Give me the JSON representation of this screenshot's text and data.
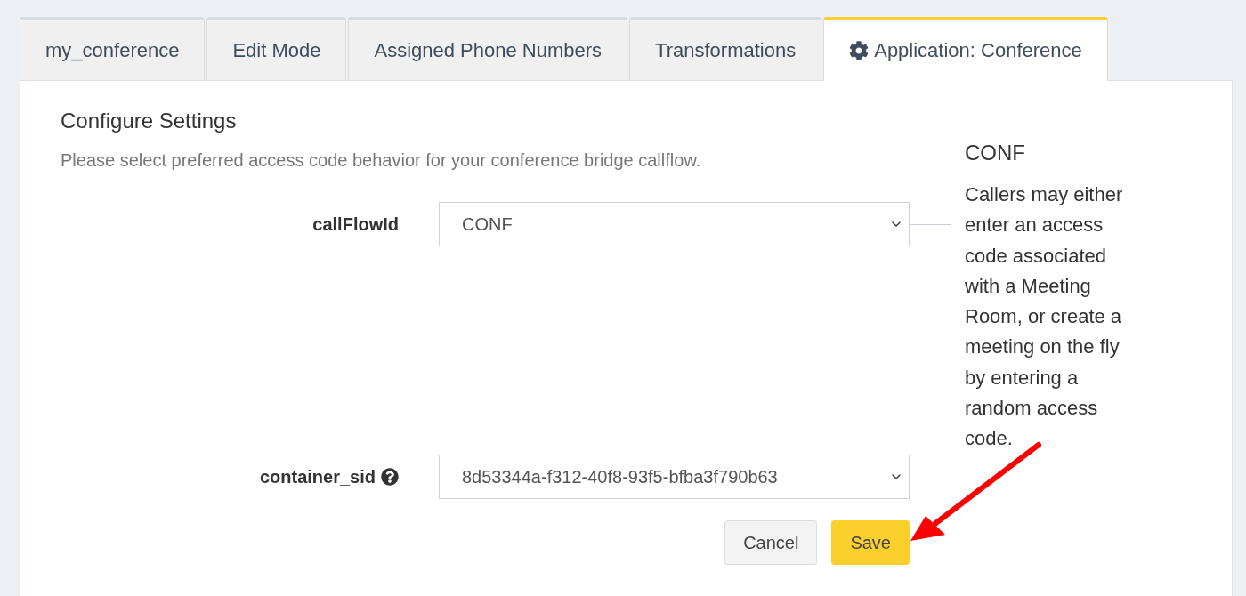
{
  "tabs": [
    {
      "label": "my_conference",
      "selected": false,
      "kind": "plain"
    },
    {
      "label": "Edit Mode",
      "selected": false,
      "kind": "plain"
    },
    {
      "label": "Assigned Phone Numbers",
      "selected": false,
      "kind": "plain"
    },
    {
      "label": "Transformations",
      "selected": false,
      "kind": "plain"
    },
    {
      "label": "Application: Conference",
      "selected": true,
      "kind": "settings"
    }
  ],
  "form": {
    "heading": "Configure Settings",
    "description": "Please select preferred access code behavior for your conference bridge callflow.",
    "fields": [
      {
        "label": "callFlowId",
        "value": "CONF",
        "help_icon": false
      },
      {
        "label": "container_sid",
        "value": "8d53344a-f312-40f8-93f5-bfba3f790b63",
        "help_icon": true
      }
    ],
    "help": {
      "title": "CONF",
      "text": "Callers may either enter an access code associated with a Meeting Room, or create a meeting on the fly by entering a random access code."
    },
    "buttons": [
      {
        "label": "Cancel",
        "kind": "secondary"
      },
      {
        "label": "Save",
        "kind": "primary"
      }
    ]
  }
}
